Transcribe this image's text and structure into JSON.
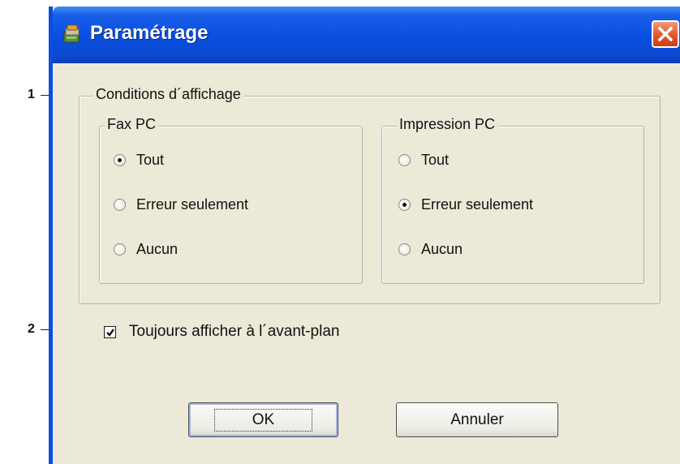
{
  "window": {
    "title": "Paramétrage"
  },
  "callouts": {
    "one": "1",
    "two": "2"
  },
  "display_conditions": {
    "legend": "Conditions d´affichage",
    "fax_pc": {
      "legend": "Fax PC",
      "options": [
        "Tout",
        "Erreur seulement",
        "Aucun"
      ],
      "selected": "Tout"
    },
    "impression_pc": {
      "legend": "Impression PC",
      "options": [
        "Tout",
        "Erreur seulement",
        "Aucun"
      ],
      "selected": "Erreur seulement"
    }
  },
  "always_on_top": {
    "label": "Toujours afficher à l´avant-plan",
    "checked": true
  },
  "buttons": {
    "ok": "OK",
    "cancel": "Annuler"
  },
  "icons": {
    "app": "settings-app-icon",
    "close": "close-icon"
  },
  "colors": {
    "titlebar": "#0a4fe0",
    "dialog_bg": "#ece9d8",
    "close_button": "#e1562a"
  }
}
